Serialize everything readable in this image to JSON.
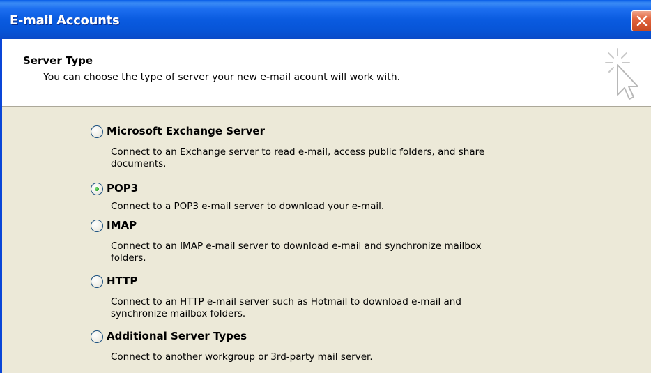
{
  "window": {
    "title": "E-mail Accounts",
    "close_icon": "close-icon",
    "title_bar_color": "#0a5be0",
    "body_color": "#ece9d8"
  },
  "header": {
    "section_title": "Server Type",
    "subtitle": "You can choose the type of server your new e-mail acount will work with.",
    "icon": "wizard-cursor-icon"
  },
  "options": [
    {
      "label": "Microsoft Exchange Server",
      "selected": false,
      "desc_line1": "Connect to an Exchange server to read e-mail, access public folders, and share",
      "desc_line2": "documents."
    },
    {
      "label": "POP3",
      "selected": true,
      "desc_line1": "Connect to a POP3 e-mail server to download your e-mail.",
      "desc_line2": ""
    },
    {
      "label": "IMAP",
      "selected": false,
      "desc_line1": "Connect to an IMAP e-mail server to download e-mail and synchronize mailbox",
      "desc_line2": "folders."
    },
    {
      "label": "HTTP",
      "selected": false,
      "desc_line1": "Connect to an HTTP e-mail server such as Hotmail to download e-mail and",
      "desc_line2": "synchronize mailbox folders."
    },
    {
      "label": "Additional Server Types",
      "selected": false,
      "desc_line1": "Connect to another workgroup or 3rd-party mail server.",
      "desc_line2": ""
    }
  ]
}
